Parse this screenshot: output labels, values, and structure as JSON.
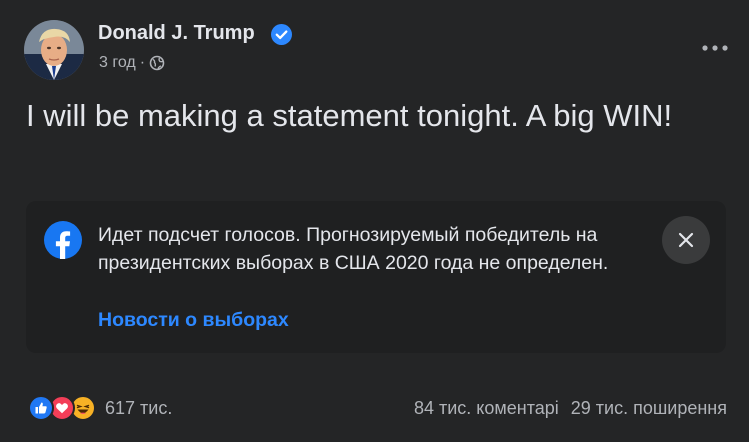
{
  "post": {
    "author": "Donald J. Trump",
    "time": "3 год",
    "separator": "·",
    "text": "I will be making a statement tonight. A big WIN!"
  },
  "notice": {
    "text": "Идет подсчет голосов. Прогнозируемый победитель на президентских выборах в США 2020 года не определен.",
    "link": "Новости о выборах"
  },
  "stats": {
    "reactions_count": "617 тис.",
    "comments": "84 тис. коментарі",
    "shares": "29 тис. поширення"
  },
  "icons": {
    "verified": "verified-badge-icon",
    "audience": "globe-icon",
    "more": "more-options-icon",
    "facebook": "facebook-logo-icon",
    "close": "close-icon",
    "reactions": [
      "like-icon",
      "love-icon",
      "haha-icon"
    ]
  },
  "colors": {
    "background": "#242526",
    "notice_background": "#1f2021",
    "link": "#2d88ff",
    "verified": "#2d88ff",
    "primary_text": "#e4e6eb",
    "secondary_text": "#b0b3b8"
  }
}
